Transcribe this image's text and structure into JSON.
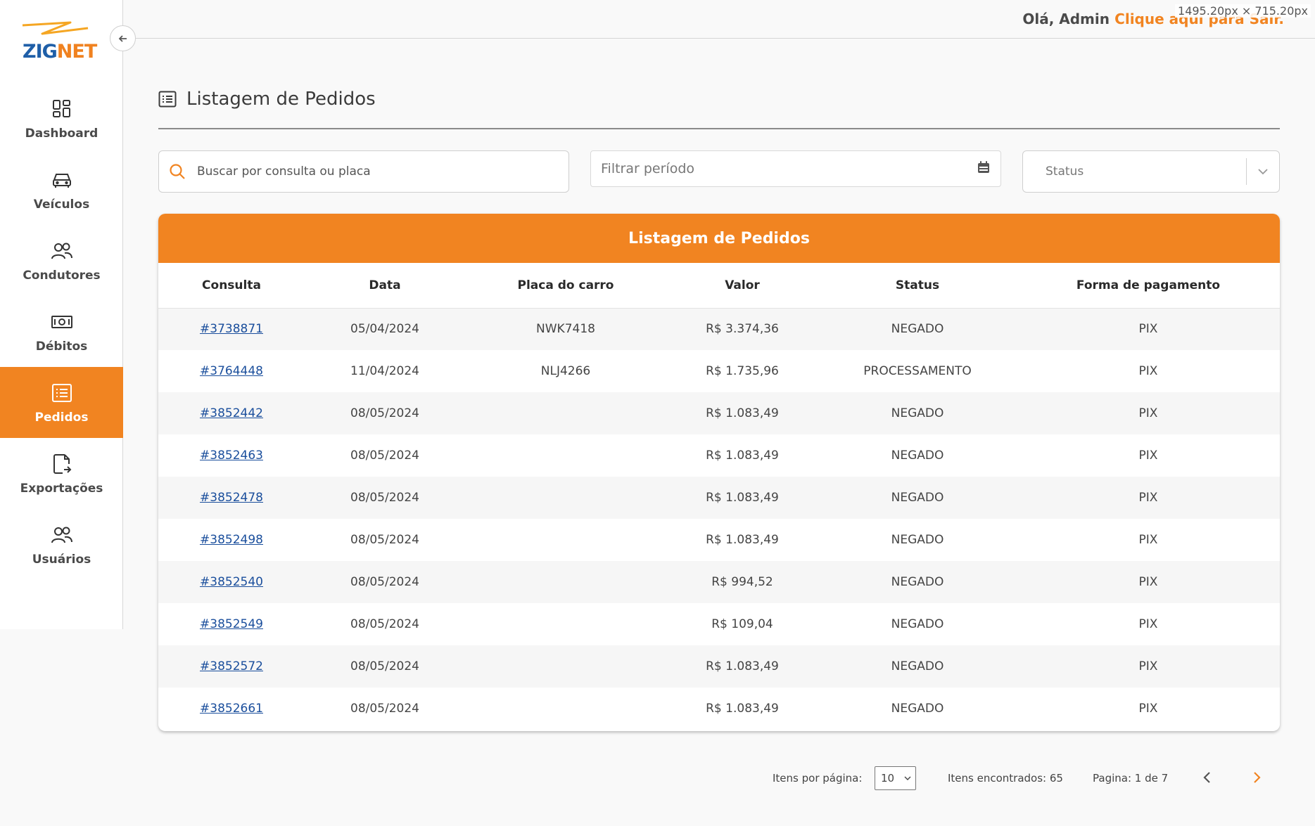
{
  "app": {
    "logo_text_a": "ZIG",
    "logo_text_b": "NET",
    "brand_color": "#f18421",
    "brand_blue": "#1f5fa8"
  },
  "header": {
    "greeting": "Olá, Admin",
    "logout_link": "Clique aqui para Sair.",
    "devtools_dims": "1495.20px × 715.20px"
  },
  "sidebar": {
    "items": [
      {
        "label": "Dashboard",
        "icon": "dashboard-icon"
      },
      {
        "label": "Veículos",
        "icon": "car-icon"
      },
      {
        "label": "Condutores",
        "icon": "users-icon"
      },
      {
        "label": "Débitos",
        "icon": "money-icon"
      },
      {
        "label": "Pedidos",
        "icon": "list-icon",
        "active": true
      },
      {
        "label": "Exportações",
        "icon": "file-export-icon"
      },
      {
        "label": "Usuários",
        "icon": "users-icon"
      }
    ]
  },
  "page": {
    "title": "Listagem de Pedidos"
  },
  "filters": {
    "search_placeholder": "Buscar por consulta ou placa",
    "period_placeholder": "Filtrar período",
    "status_placeholder": "Status"
  },
  "table": {
    "title": "Listagem de Pedidos",
    "columns": [
      "Consulta",
      "Data",
      "Placa do carro",
      "Valor",
      "Status",
      "Forma de pagamento"
    ],
    "rows": [
      {
        "consulta": "#3738871",
        "data": "05/04/2024",
        "placa": "NWK7418",
        "valor": "R$ 3.374,36",
        "status": "NEGADO",
        "pagamento": "PIX"
      },
      {
        "consulta": "#3764448",
        "data": "11/04/2024",
        "placa": "NLJ4266",
        "valor": "R$ 1.735,96",
        "status": "PROCESSAMENTO",
        "pagamento": "PIX"
      },
      {
        "consulta": "#3852442",
        "data": "08/05/2024",
        "placa": "",
        "valor": "R$ 1.083,49",
        "status": "NEGADO",
        "pagamento": "PIX"
      },
      {
        "consulta": "#3852463",
        "data": "08/05/2024",
        "placa": "",
        "valor": "R$ 1.083,49",
        "status": "NEGADO",
        "pagamento": "PIX"
      },
      {
        "consulta": "#3852478",
        "data": "08/05/2024",
        "placa": "",
        "valor": "R$ 1.083,49",
        "status": "NEGADO",
        "pagamento": "PIX"
      },
      {
        "consulta": "#3852498",
        "data": "08/05/2024",
        "placa": "",
        "valor": "R$ 1.083,49",
        "status": "NEGADO",
        "pagamento": "PIX"
      },
      {
        "consulta": "#3852540",
        "data": "08/05/2024",
        "placa": "",
        "valor": "R$ 994,52",
        "status": "NEGADO",
        "pagamento": "PIX"
      },
      {
        "consulta": "#3852549",
        "data": "08/05/2024",
        "placa": "",
        "valor": "R$ 109,04",
        "status": "NEGADO",
        "pagamento": "PIX"
      },
      {
        "consulta": "#3852572",
        "data": "08/05/2024",
        "placa": "",
        "valor": "R$ 1.083,49",
        "status": "NEGADO",
        "pagamento": "PIX"
      },
      {
        "consulta": "#3852661",
        "data": "08/05/2024",
        "placa": "",
        "valor": "R$ 1.083,49",
        "status": "NEGADO",
        "pagamento": "PIX"
      }
    ]
  },
  "pagination": {
    "per_page_label": "Itens por página:",
    "per_page_value": "10",
    "found_label": "Itens encontrados: 65",
    "page_label": "Pagina: 1 de 7"
  }
}
